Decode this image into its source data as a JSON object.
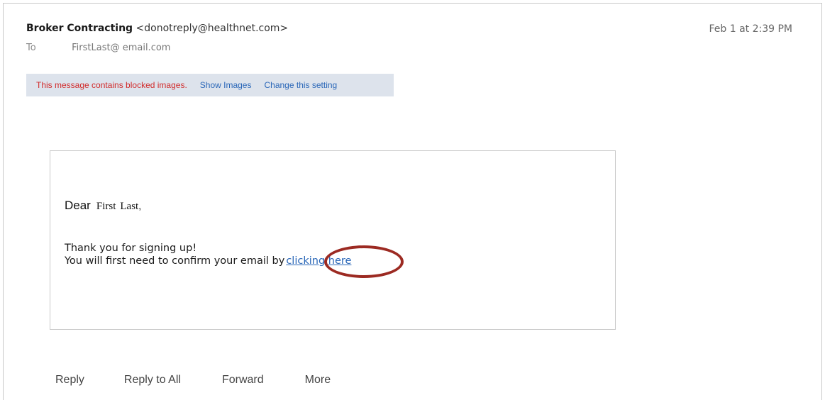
{
  "header": {
    "sender_name": "Broker Contracting",
    "sender_address": "<donotreply@healthnet.com>",
    "date": "Feb 1 at 2:39 PM",
    "to_label": "To",
    "to_value": "FirstLast@ email.com"
  },
  "blocked_bar": {
    "warning": "This message contains blocked images.",
    "show_images": "Show Images",
    "change_setting": "Change this setting"
  },
  "body": {
    "dear": "Dear",
    "first": "First",
    "last": "Last",
    "comma": ",",
    "line1": "Thank you for signing up!",
    "line2": "You will first need to confirm your email by",
    "link": "clicking here"
  },
  "actions": {
    "reply": "Reply",
    "reply_all": "Reply to All",
    "forward": "Forward",
    "more": "More"
  },
  "colors": {
    "warning": "#d12b2b",
    "link": "#2a67b8",
    "highlight": "#9c2a22",
    "bar": "#dde3ec"
  }
}
